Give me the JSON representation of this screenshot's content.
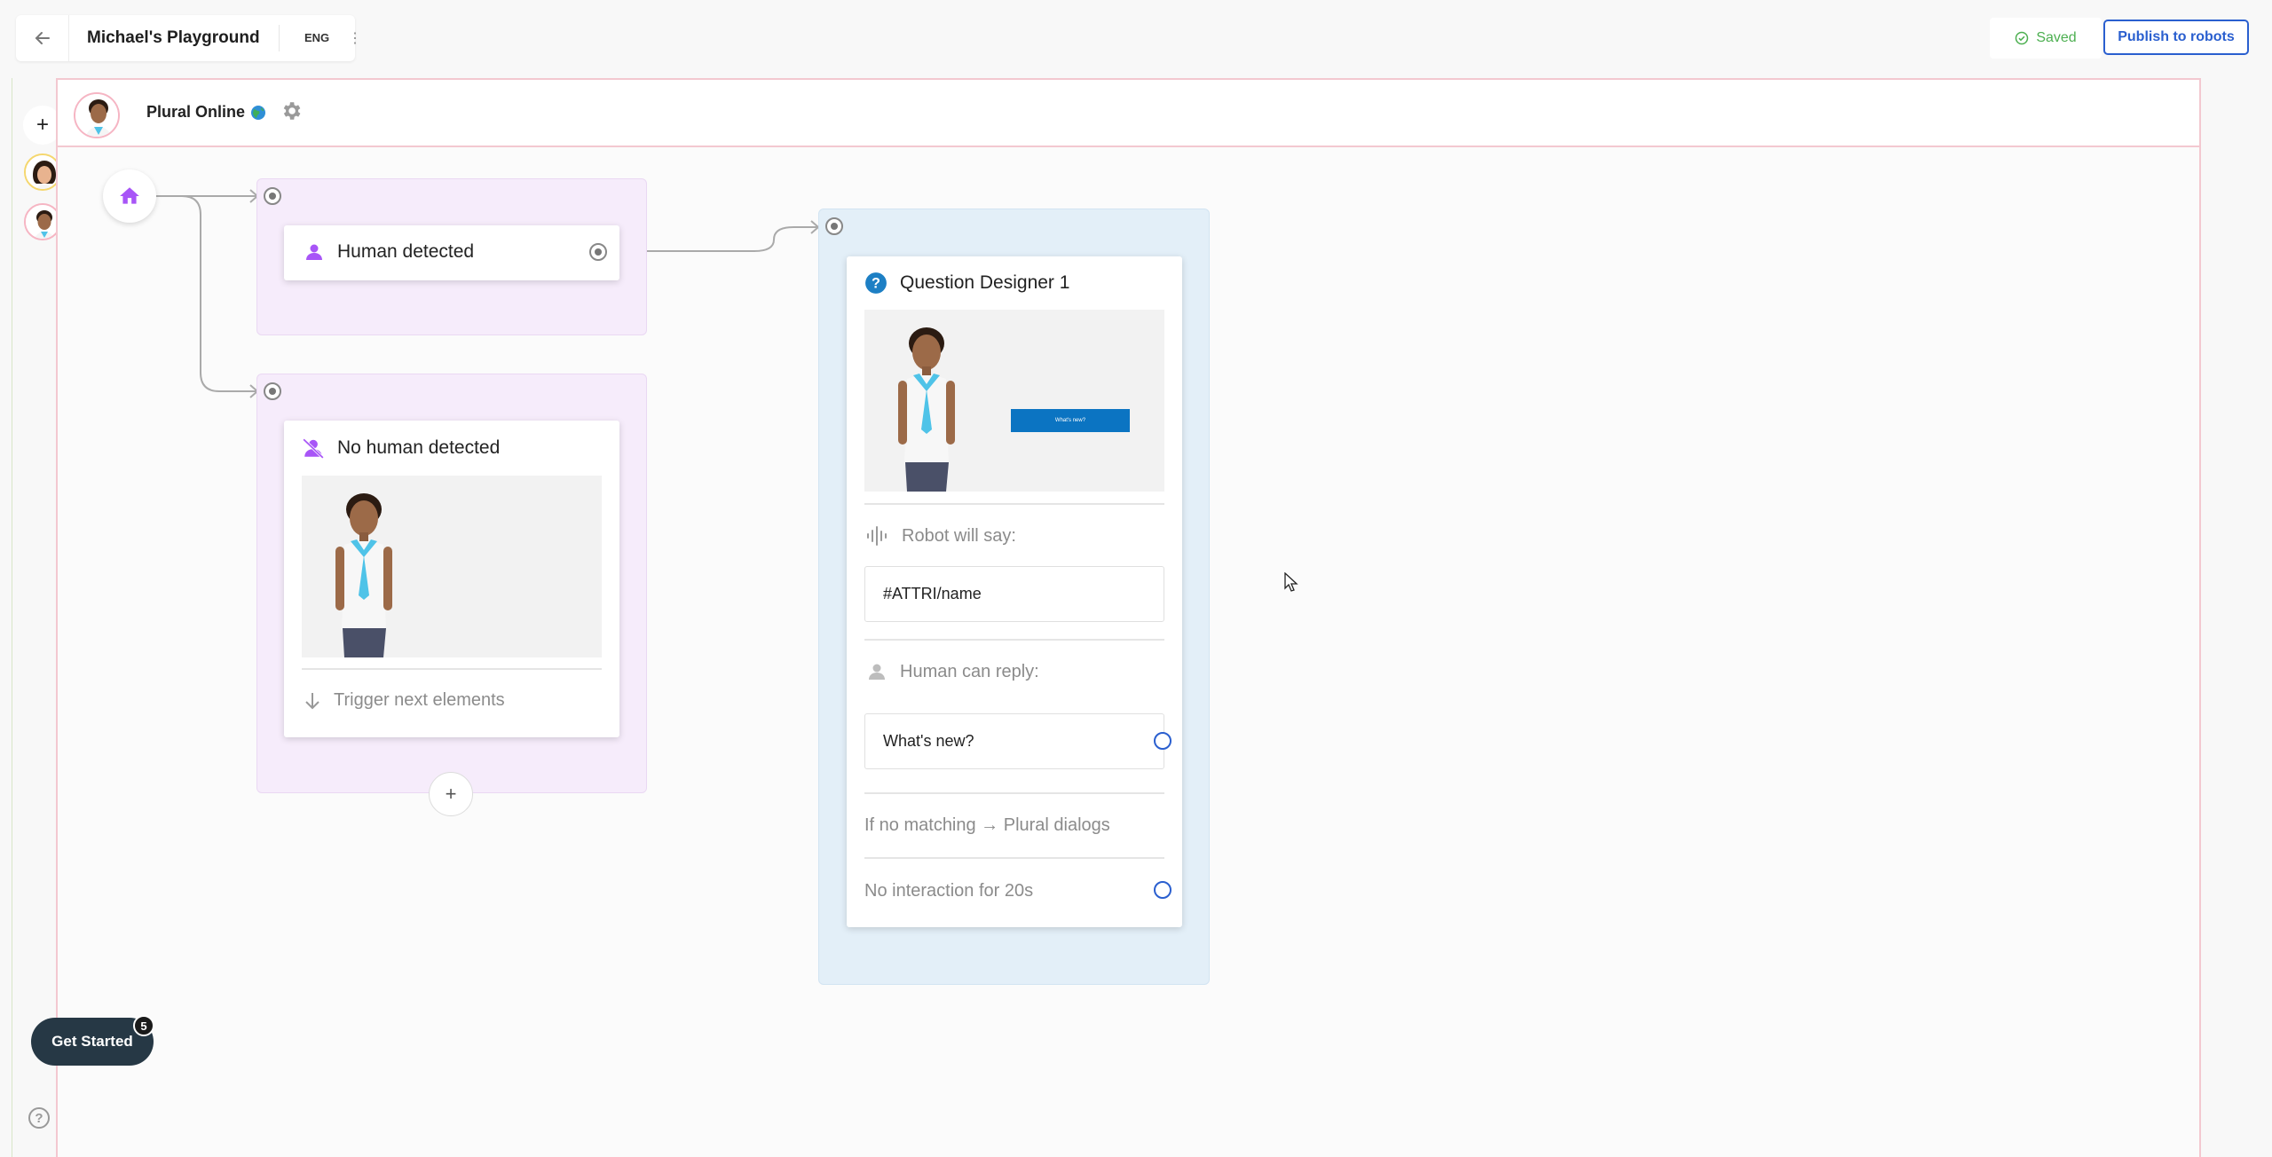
{
  "header": {
    "project_title": "Michael's Playground",
    "language": "ENG",
    "saved_label": "Saved",
    "publish_label": "Publish to robots"
  },
  "canvas": {
    "persona_name": "Plural Online"
  },
  "nodes": {
    "human_detected": {
      "title": "Human detected"
    },
    "no_human_detected": {
      "title": "No human detected",
      "footer": "Trigger next elements"
    },
    "question_designer": {
      "title": "Question Designer 1",
      "preview_button": "What's new?",
      "robot_will_say_label": "Robot will say:",
      "robot_will_say_value": "#ATTRI/name",
      "human_can_reply_label": "Human can reply:",
      "reply_value": "What's new?",
      "no_match_label": "If no matching → Plural dialogs",
      "no_interaction_label": "No interaction for 20s"
    }
  },
  "onboarding": {
    "get_started_label": "Get Started",
    "badge_count": "5"
  },
  "colors": {
    "accent_blue": "#2a5fcf",
    "purple_group": "#f6ecfb",
    "blue_group": "#e3eff8",
    "saved_green": "#4caf50",
    "icon_purple": "#a855f7"
  }
}
